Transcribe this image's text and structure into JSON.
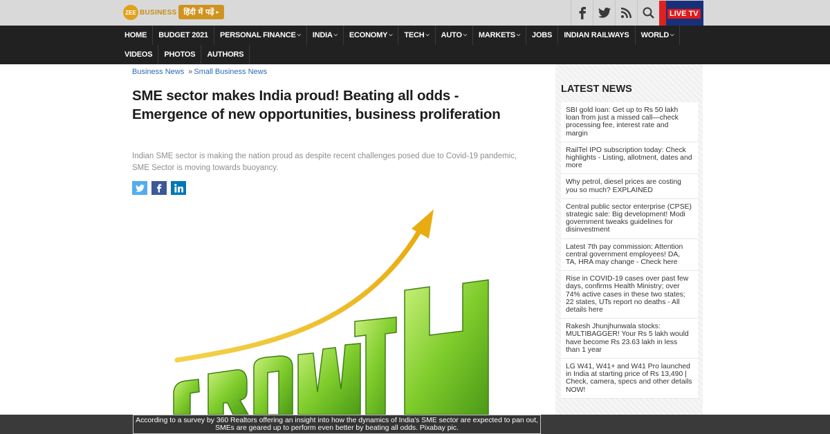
{
  "header": {
    "logo_badge": "ZEE",
    "logo_text": "BUSINESS",
    "hindi_button": "हिंदी में पढ़ें",
    "social_icons": [
      "facebook-icon",
      "twitter-icon",
      "rss-icon",
      "search-icon"
    ],
    "live_tv": "LIVE TV"
  },
  "nav": {
    "row1": [
      {
        "label": "HOME",
        "dropdown": false
      },
      {
        "label": "BUDGET 2021",
        "dropdown": false
      },
      {
        "label": "PERSONAL FINANCE",
        "dropdown": true
      },
      {
        "label": "INDIA",
        "dropdown": true
      },
      {
        "label": "ECONOMY",
        "dropdown": true
      },
      {
        "label": "TECH",
        "dropdown": true
      },
      {
        "label": "AUTO",
        "dropdown": true
      },
      {
        "label": "MARKETS",
        "dropdown": true
      },
      {
        "label": "JOBS",
        "dropdown": false
      },
      {
        "label": "INDIAN RAILWAYS",
        "dropdown": false
      },
      {
        "label": "WORLD",
        "dropdown": true
      }
    ],
    "row2": [
      {
        "label": "VIDEOS"
      },
      {
        "label": "PHOTOS"
      },
      {
        "label": "AUTHORS"
      }
    ]
  },
  "article": {
    "breadcrumb": [
      "Business News",
      "»",
      "Small Business News"
    ],
    "headline": "SME sector makes India proud! Beating all odds - Emergence of new opportunities, business proliferation",
    "summary": "Indian SME sector is making the nation proud as despite recent challenges posed due to Covid-19 pandemic, SME Sector is moving towards buoyancy.",
    "share": [
      "twitter-icon",
      "facebook-icon",
      "linkedin-icon"
    ],
    "hero_word": "GROWTH",
    "caption": "According to a survey by 360 Realtors offering an insight into how the dynamics of India's SME sector are expected to pan out, SMEs are geared up to perform even better by beating all odds. Pixabay pic."
  },
  "sidebar": {
    "title": "LATEST NEWS",
    "items": [
      "SBI gold loan: Get up to Rs 50 lakh loan from just a missed call—check processing fee, interest rate and margin",
      "RailTel IPO subscription today: Check highlights - Listing, allotment, dates and more",
      "Why petrol, diesel prices are costing you so much? EXPLAINED",
      "Central public sector enterprise (CPSE) strategic sale: Big development! Modi government tweaks guidelines for disinvestment",
      "Latest 7th pay commission: Attention central government employees! DA, TA, HRA may change - Check here",
      "Rise in COVID-19 cases over past few days, confirms Health Ministry; over 74% active cases in these two states; 22 states, UTs report no deaths - All details here",
      "Rakesh Jhunjhunwala stocks: MULTIBAGGER! Your Rs 5 lakh would have become Rs 23.63 lakh in less than 1 year",
      "LG W41, W41+ and W41 Pro launched in India at starting price of Rs 13,490 | Check, camera, specs and other details NOW!"
    ]
  },
  "colors": {
    "nav_bg": "#212121",
    "accent_gold": "#cf9320",
    "link_blue": "#2a6bb4",
    "live_red": "#e11a1a"
  }
}
